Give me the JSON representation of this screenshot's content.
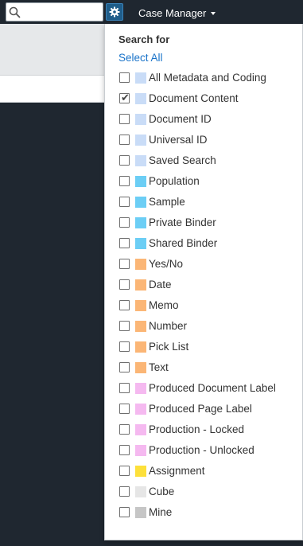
{
  "topbar": {
    "search_placeholder": "",
    "case_manager_label": "Case Manager"
  },
  "dropdown": {
    "title": "Search for",
    "select_all_label": "Select All",
    "items": [
      {
        "label": "All Metadata and Coding",
        "checked": false,
        "color": "#c9dcf7"
      },
      {
        "label": "Document Content",
        "checked": true,
        "color": "#c9dcf7"
      },
      {
        "label": "Document ID",
        "checked": false,
        "color": "#c9dcf7"
      },
      {
        "label": "Universal ID",
        "checked": false,
        "color": "#c9dcf7"
      },
      {
        "label": "Saved Search",
        "checked": false,
        "color": "#c9dcf7"
      },
      {
        "label": "Population",
        "checked": false,
        "color": "#6ccef5"
      },
      {
        "label": "Sample",
        "checked": false,
        "color": "#6ccef5"
      },
      {
        "label": "Private Binder",
        "checked": false,
        "color": "#6ccef5"
      },
      {
        "label": "Shared Binder",
        "checked": false,
        "color": "#6ccef5"
      },
      {
        "label": "Yes/No",
        "checked": false,
        "color": "#fbb676"
      },
      {
        "label": "Date",
        "checked": false,
        "color": "#fbb676"
      },
      {
        "label": "Memo",
        "checked": false,
        "color": "#fbb676"
      },
      {
        "label": "Number",
        "checked": false,
        "color": "#fbb676"
      },
      {
        "label": "Pick List",
        "checked": false,
        "color": "#fbb676"
      },
      {
        "label": "Text",
        "checked": false,
        "color": "#fbb676"
      },
      {
        "label": "Produced Document Label",
        "checked": false,
        "color": "#f5b9f0"
      },
      {
        "label": "Produced Page Label",
        "checked": false,
        "color": "#f5b9f0"
      },
      {
        "label": "Production - Locked",
        "checked": false,
        "color": "#f5b9f0"
      },
      {
        "label": "Production - Unlocked",
        "checked": false,
        "color": "#f5b9f0"
      },
      {
        "label": "Assignment",
        "checked": false,
        "color": "#fde03a"
      },
      {
        "label": "Cube",
        "checked": false,
        "color": "#e6e6e6"
      },
      {
        "label": "Mine",
        "checked": false,
        "color": "#c6c6c6"
      }
    ]
  },
  "icons": {
    "search": "search-icon",
    "settings": "gear-icon",
    "caret": "caret-down-icon",
    "check": "check-icon"
  }
}
